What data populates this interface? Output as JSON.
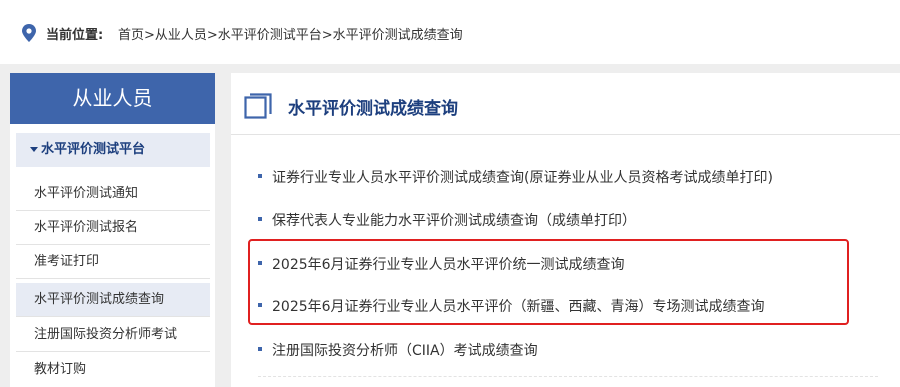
{
  "breadcrumb": {
    "label": "当前位置:",
    "path": "首页>从业人员>水平评价测试平台>水平评价测试成绩查询"
  },
  "sidebar": {
    "title": "从业人员",
    "group": "水平评价测试平台",
    "items": [
      {
        "label": "水平评价测试通知"
      },
      {
        "label": "水平评价测试报名"
      },
      {
        "label": "准考证打印"
      },
      {
        "label": "水平评价测试成绩查询"
      },
      {
        "label": "注册国际投资分析师考试"
      },
      {
        "label": "教材订购"
      }
    ]
  },
  "main": {
    "title": "水平评价测试成绩查询",
    "links": [
      {
        "label": "证券行业专业人员水平评价测试成绩查询(原证券业从业人员资格考试成绩单打印)"
      },
      {
        "label": "保荐代表人专业能力水平评价测试成绩查询（成绩单打印）"
      },
      {
        "label": "2025年6月证券行业专业人员水平评价统一测试成绩查询"
      },
      {
        "label": "2025年6月证券行业专业人员水平评价（新疆、西藏、青海）专场测试成绩查询"
      },
      {
        "label": "注册国际投资分析师（CIIA）考试成绩查询"
      }
    ]
  },
  "icons": {
    "location": "location-pin-icon",
    "section": "window-frame-icon"
  },
  "colors": {
    "brand_blue": "#3e65ab",
    "highlight_red": "#e02020"
  }
}
